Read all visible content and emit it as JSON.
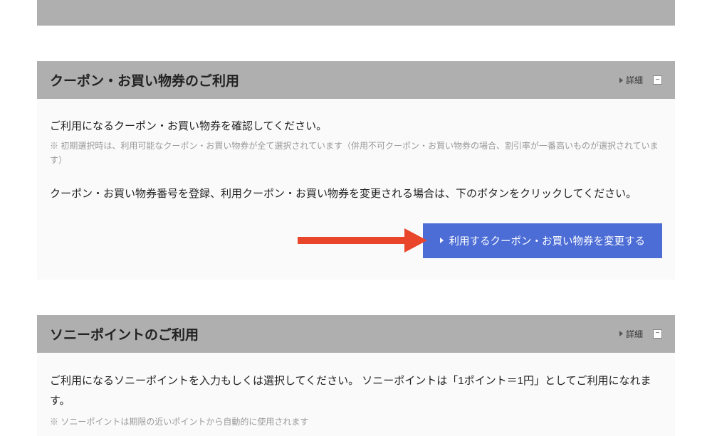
{
  "coupon": {
    "title": "クーポン・お買い物券のご利用",
    "detail_label": "詳細",
    "line1": "ご利用になるクーポン・お買い物券を確認してください。",
    "note": "※ 初期選択時は、利用可能なクーポン・お買い物券が全て選択されています（併用不可クーポン・お買い物券の場合、割引率が一番高いものが選択されています）",
    "line2": "クーポン・お買い物券番号を登録、利用クーポン・お買い物券を変更される場合は、下のボタンをクリックしてください。",
    "button_label": "利用するクーポン・お買い物券を変更する"
  },
  "points": {
    "title": "ソニーポイントのご利用",
    "detail_label": "詳細",
    "line1": "ご利用になるソニーポイントを入力もしくは選択してください。 ソニーポイントは「1ポイント＝1円」としてご利用になれます。",
    "note": "※ ソニーポイントは期限の近いポイントから自動的に使用されます"
  }
}
